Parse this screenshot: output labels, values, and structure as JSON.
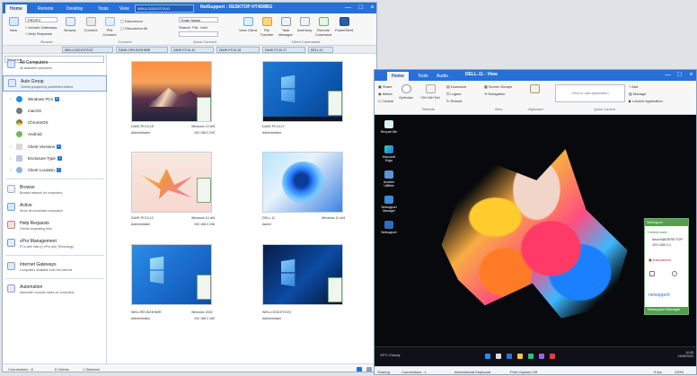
{
  "main_window": {
    "tabs": [
      "Home",
      "Remote",
      "Desktop",
      "Tools",
      "View"
    ],
    "document_tab": "WIN-LOG01STGVO",
    "title": "NetSupport : DESKTOP HT4D8BG",
    "ribbon": {
      "new_label": "New",
      "browse_label": "Browse",
      "include_gateways": "Include Gateways",
      "help_requests": "Help Requests",
      "profile_value": "PROFO",
      "group_labels": {
        "browse": "Browse",
        "connect": "Connect",
        "quick_connect": "Quick Connect",
        "client_commands": "Client Commands"
      },
      "connect_buttons": [
        "Connect",
        "PIN Connect"
      ],
      "disconnect_buttons": [
        "Disconnect",
        "Disconnect All"
      ],
      "quick_connect_value": "Enter Name",
      "quick_connect_options": [
        "Shared",
        "File",
        "User"
      ],
      "client_commands": [
        "View Client",
        "File Transfer",
        "Task Manager",
        "Inventory",
        "Remote Command",
        "PowerShell"
      ]
    },
    "open_tabs": [
      "WIN-LOG01STGVO",
      "DAVE-CRHJKZ3HMIR",
      "DAVE-PC10-12",
      "DAVE-PC10-15",
      "DAVE-PC10-17",
      "DELL-11"
    ],
    "sidebar": {
      "recent_label": "Recent",
      "items": [
        {
          "label": "All Computers",
          "sub": "All available computers"
        },
        {
          "label": "Auto Group",
          "sub": "Clients grouped by predefined criteria"
        }
      ],
      "tree": [
        {
          "label": "Windows PCs",
          "badge": "6"
        },
        {
          "label": "macOS",
          "badge": ""
        },
        {
          "label": "ChromeOS",
          "badge": ""
        },
        {
          "label": "Android",
          "badge": ""
        },
        {
          "label": "Client Versions",
          "badge": "1"
        },
        {
          "label": "Enclosure Type",
          "badge": "1"
        },
        {
          "label": "Client Location",
          "badge": "1"
        }
      ],
      "sections": [
        {
          "label": "Browse",
          "sub": "Browse network for computers"
        },
        {
          "label": "Active",
          "sub": "Show all connected computers"
        },
        {
          "label": "Help Requests",
          "sub": "Clients requesting help"
        },
        {
          "label": "vPro Management",
          "sub": "PCs with Intel (r) vPro (tm) Technology"
        },
        {
          "label": "Internet Gateways",
          "sub": "Computers available over the Internet"
        },
        {
          "label": "Automation",
          "sub": "Automate common tasks on computers"
        }
      ]
    },
    "computers": [
      {
        "name": "DAVE-PC10-15",
        "os": "Windows 10 x64",
        "user": "Administrator",
        "ip": "192.168.2.249"
      },
      {
        "name": "DAVE-PC10-17",
        "os": "",
        "user": "Administrator",
        "ip": ""
      },
      {
        "name": "DAVE-PC10-12",
        "os": "Windows 10 x64",
        "user": "Administrator",
        "ip": "192.168.2.246"
      },
      {
        "name": "DELL-11",
        "os": "Windows 11 x64",
        "user": "dave4",
        "ip": ""
      },
      {
        "name": "WIN-CRHJKZ3HMIR",
        "os": "Windows 2022",
        "user": "Administrator",
        "ip": "192.168.2.160"
      },
      {
        "name": "WIN-LOG01STGVO",
        "os": "",
        "user": "Administrator",
        "ip": ""
      }
    ],
    "status": {
      "connections": "Connections : 6",
      "clients": "6 Clients",
      "selected": "1 Selected"
    }
  },
  "viewer": {
    "title": "DELL-11 - View",
    "tabs": [
      "Home",
      "Tools",
      "Audio"
    ],
    "ribbon": {
      "share": "Share",
      "watch": "Watch",
      "control": "Control",
      "optimise": "Optimise",
      "ctrl_alt_del": "Ctrl+Alt+Del",
      "downsize": "Downsize",
      "logout": "Logout",
      "reboot": "Reboot",
      "screen_scrape": "Screen Scrape",
      "navigation": "Navigation",
      "clipboard": "Clipboard",
      "quick_launch_placeholder": "Click to add application",
      "add": "Add",
      "manage": "Manage",
      "launch_application": "Launch Application",
      "group_labels": [
        "Remote",
        "View",
        "Clipboard",
        "Quick Launch"
      ]
    },
    "desktop_icons": [
      "Recycle Bin",
      "Microsoft Edge",
      "Another Utilities",
      "Netsupport Manager",
      "Netsupport"
    ],
    "panel": {
      "title": "NetSupport",
      "control_user": "Control user",
      "user": "dave4@DESKTOP",
      "ip": "192.168.2.1",
      "disconnect": "Disconnect",
      "brand": "netsupport",
      "footer": "Netsupport Manager"
    },
    "taskbar": {
      "weather": "19°C Cloudy",
      "time": "10:43",
      "date": "14/05/2024"
    },
    "status": {
      "sharing": "Sharing",
      "connections": "Connections : 1",
      "keyboard": "International Keyboard",
      "capture": "Print Capture Off",
      "fps": "9 fps",
      "zoom": "100%"
    }
  },
  "colors": {
    "primary": "#2670d8",
    "ribbon": "#f7f7f8",
    "accent_green": "#52a04e",
    "selected": "#eaf3ff"
  },
  "icons": [
    "search-icon",
    "computer-icon",
    "folder-icon",
    "help-icon",
    "vpro-icon",
    "gateway-icon",
    "automation-icon",
    "disconnect-icon"
  ]
}
